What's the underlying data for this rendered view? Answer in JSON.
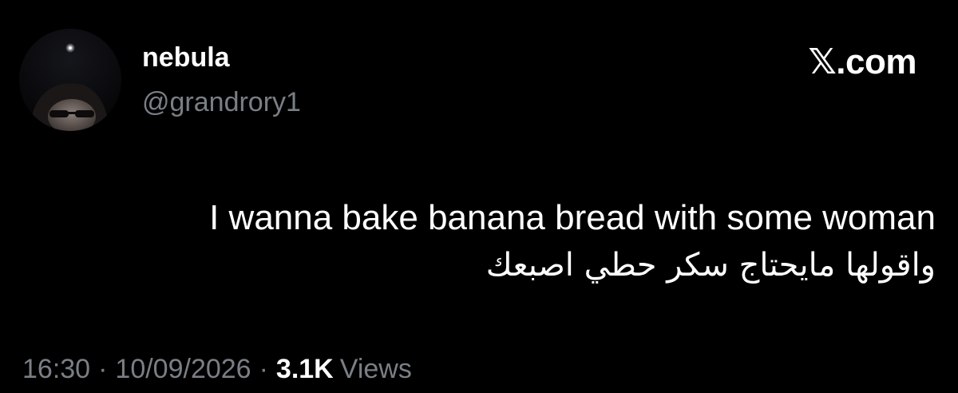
{
  "author": {
    "display_name": "nebula",
    "handle": "@grandrory1",
    "avatar_icon": "profile-photo-icon"
  },
  "brand": {
    "label": "𝕏.com"
  },
  "tweet": {
    "line_1": "I wanna bake banana bread with some woman",
    "line_2": "واقولها مايحتاج سكر حطي اصبعك"
  },
  "meta": {
    "time": "16:30",
    "separator": "·",
    "date": "10/09/2026",
    "views_count": "3.1K",
    "views_label": "Views"
  },
  "colors": {
    "background": "#000000",
    "primary_text": "#ffffff",
    "secondary_text": "#7a7f85"
  }
}
